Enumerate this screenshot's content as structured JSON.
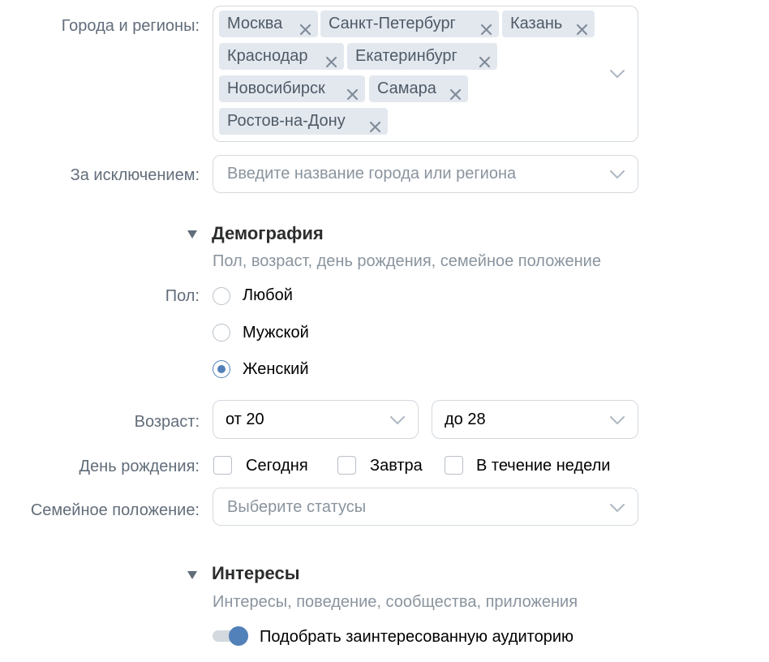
{
  "geo": {
    "cities_label": "Города и регионы:",
    "cities": [
      "Москва",
      "Санкт-Петербург",
      "Казань",
      "Краснодар",
      "Екатеринбург",
      "Новосибирск",
      "Самара",
      "Ростов-на-Дону"
    ],
    "except_label": "За исключением:",
    "except_placeholder": "Введите название города или региона"
  },
  "demography": {
    "title": "Демография",
    "subtitle": "Пол, возраст, день рождения, семейное положение",
    "gender_label": "Пол:",
    "gender_options": [
      "Любой",
      "Мужской",
      "Женский"
    ],
    "gender_selected": "Женский",
    "age_label": "Возраст:",
    "age_from": "от 20",
    "age_to": "до 28",
    "birthday_label": "День рождения:",
    "birthday_options": [
      "Сегодня",
      "Завтра",
      "В течение недели"
    ],
    "family_label": "Семейное положение:",
    "family_placeholder": "Выберите статусы"
  },
  "interests": {
    "title": "Интересы",
    "subtitle": "Интересы, поведение, сообщества, приложения",
    "toggle_label": "Подобрать заинтересованную аудиторию",
    "toggle_on": true
  },
  "colors": {
    "accent": "#5181b8",
    "tag_bg": "#e3e8ef",
    "label": "#626d7a",
    "placeholder": "#8a949e",
    "border": "#d3d9de"
  },
  "icons": {
    "remove": "close-icon",
    "dropdown": "chevron-down-icon",
    "section": "triangle-down-icon"
  }
}
